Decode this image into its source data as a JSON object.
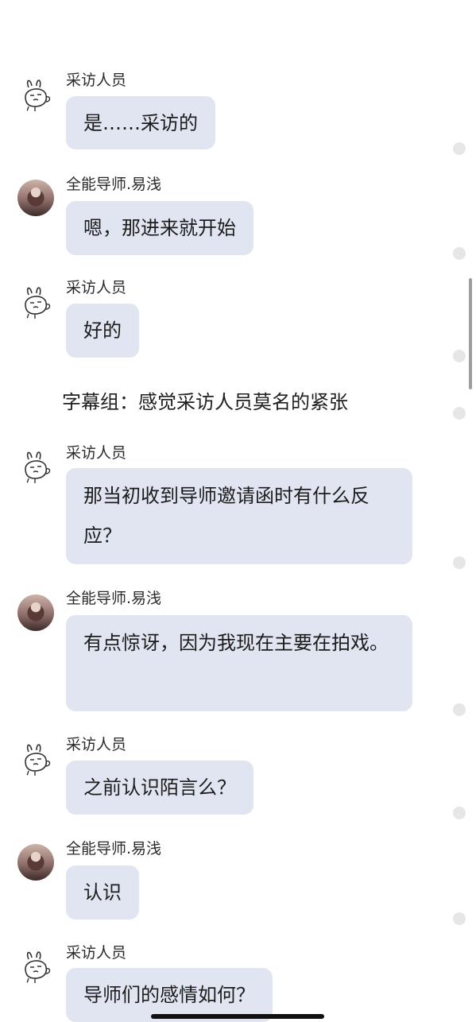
{
  "messages": [
    {
      "speaker": "采访人员",
      "avatar": "rabbit",
      "text": "是……采访的"
    },
    {
      "speaker": "全能导师.易浅",
      "avatar": "photo",
      "text": "嗯，那进来就开始"
    },
    {
      "speaker": "采访人员",
      "avatar": "rabbit",
      "text": "好的"
    },
    {
      "narration": "字幕组：感觉采访人员莫名的紧张"
    },
    {
      "speaker": "采访人员",
      "avatar": "rabbit",
      "text": "那当初收到导师邀请函时有什么反应？"
    },
    {
      "speaker": "全能导师.易浅",
      "avatar": "photo",
      "text": "有点惊讶，因为我现在主要在拍戏。"
    },
    {
      "speaker": "采访人员",
      "avatar": "rabbit",
      "text": "之前认识陌言么？"
    },
    {
      "speaker": "全能导师.易浅",
      "avatar": "photo",
      "text": "认识"
    },
    {
      "speaker": "采访人员",
      "avatar": "rabbit",
      "text": "导师们的感情如何？"
    }
  ],
  "colors": {
    "bubble": "#e1e5f1",
    "background": "#ffffff",
    "dot": "#e6e6e6"
  },
  "icons": {
    "rabbit_avatar": "rabbit-avatar-icon",
    "photo_avatar": "user-photo-avatar"
  }
}
